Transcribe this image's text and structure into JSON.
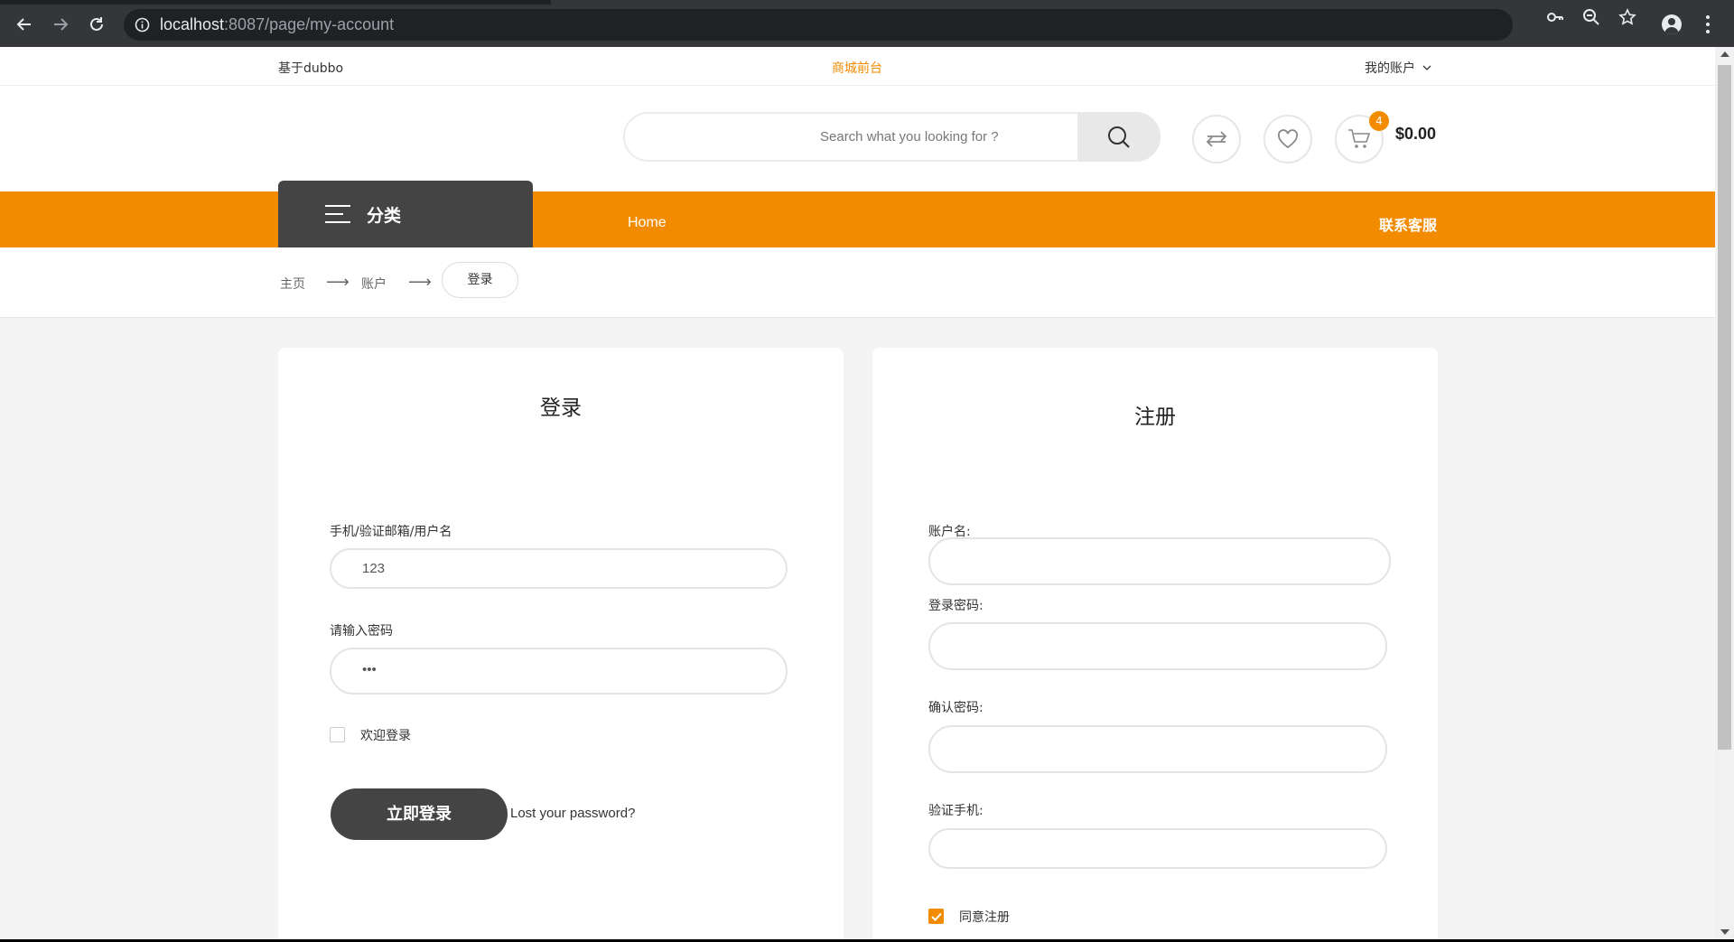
{
  "browser": {
    "url_host": "localhost",
    "url_rest": ":8087/page/my-account"
  },
  "topbar": {
    "left_text": "基于dubbo",
    "center_text": "商城前台",
    "account_label": "我的账户"
  },
  "header": {
    "search_placeholder": "Search what you looking for ?",
    "cart_count": "4",
    "cart_total": "$0.00"
  },
  "nav": {
    "category_label": "分类",
    "home_label": "Home",
    "service_label": "联系客服"
  },
  "breadcrumb": {
    "items": [
      "主页",
      "账户"
    ],
    "current": "登录"
  },
  "login": {
    "title": "登录",
    "username_label": "手机/验证邮箱/用户名",
    "username_value": "123",
    "password_label": "请输入密码",
    "password_value": "•••",
    "remember_label": "欢迎登录",
    "remember_checked": false,
    "submit_label": "立即登录",
    "lost_password_label": "Lost your password?"
  },
  "register": {
    "title": "注册",
    "account_label": "账户名:",
    "password_label": "登录密码:",
    "confirm_label": "确认密码:",
    "phone_label": "验证手机:",
    "agree_label": "同意注册",
    "agree_checked": true
  },
  "colors": {
    "accent": "#f28b00",
    "dark": "#444444",
    "chrome": "#35363a"
  }
}
